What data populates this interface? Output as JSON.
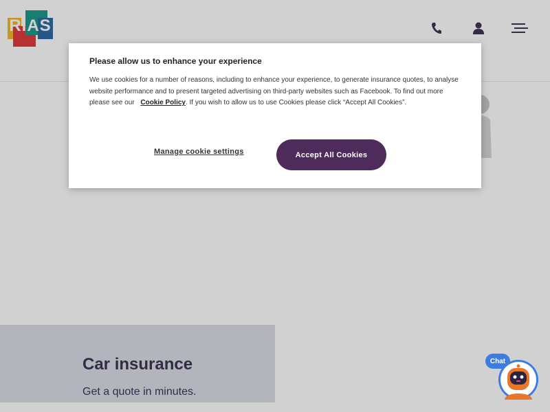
{
  "brand": {
    "logo_text": "RIAS",
    "colors": {
      "yellow": "#f2b62a",
      "red": "#e23b3f",
      "teal": "#1f9a8b",
      "blue": "#2e6ca8",
      "plum": "#4e2b5a",
      "chat_blue": "#3d7de0"
    }
  },
  "header": {
    "icons": [
      "phone-icon",
      "user-icon",
      "menu-icon"
    ]
  },
  "card": {
    "title": "Car insurance",
    "subtitle": "Get a quote in minutes."
  },
  "cookie_dialog": {
    "title": "Please allow us to enhance your experience",
    "body_text": "We use cookies for a number of reasons, including to enhance your experience, to generate insurance quotes, to analyse website performance and to present targeted advertising on third-party websites such as Facebook. To find out more please see our",
    "policy_link": "Cookie Policy",
    "body_text_after": ". If you wish to allow us to use Cookies please click “Accept All Cookies”.",
    "manage_label": "Manage cookie settings",
    "accept_label": "Accept All Cookies"
  },
  "chat": {
    "label": "Chat"
  }
}
